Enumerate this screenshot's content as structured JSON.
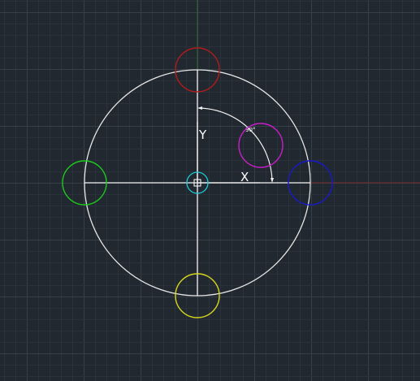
{
  "canvas": {
    "background_color": "#212830",
    "grid_minor_color": "#2a323c",
    "grid_major_color": "#364049",
    "x_axis_color": "#7a2a2a",
    "y_axis_color": "#2e6b2e"
  },
  "drawing": {
    "main_circle": {
      "color": "#e6e6e6"
    },
    "crosshair_lines": {
      "color": "#f0f0f0"
    },
    "marker_circles": [
      {
        "name": "top",
        "color": "#b01c1c"
      },
      {
        "name": "left",
        "color": "#1ec81e"
      },
      {
        "name": "right",
        "color": "#1a1ac8"
      },
      {
        "name": "bottom",
        "color": "#d6d61e"
      },
      {
        "name": "polar",
        "color": "#c81ec8"
      }
    ],
    "center_marker": {
      "color": "#1ec8d6"
    },
    "angle_arc": {
      "color": "#f0f0f0",
      "angle_text": "90°"
    },
    "ucs_icon": {
      "color": "#f0f0f0",
      "x_label": "X",
      "y_label": "Y"
    }
  }
}
